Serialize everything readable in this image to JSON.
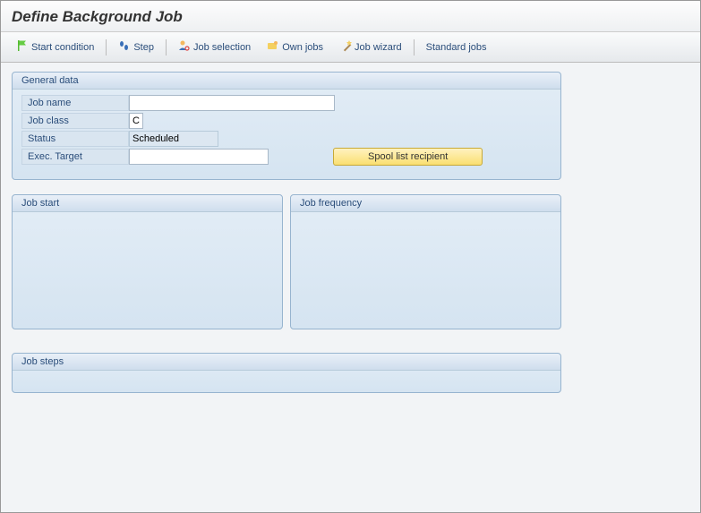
{
  "title": "Define Background Job",
  "toolbar": {
    "start_condition": "Start condition",
    "step": "Step",
    "job_selection": "Job selection",
    "own_jobs": "Own jobs",
    "job_wizard": "Job wizard",
    "standard_jobs": "Standard jobs"
  },
  "panels": {
    "general": {
      "title": "General data",
      "job_name_label": "Job name",
      "job_name_value": "",
      "job_class_label": "Job class",
      "job_class_value": "C",
      "status_label": "Status",
      "status_value": "Scheduled",
      "exec_target_label": "Exec. Target",
      "exec_target_value": "",
      "spool_button": "Spool list recipient"
    },
    "job_start": {
      "title": "Job start"
    },
    "job_frequency": {
      "title": "Job frequency"
    },
    "job_steps": {
      "title": "Job steps"
    }
  }
}
